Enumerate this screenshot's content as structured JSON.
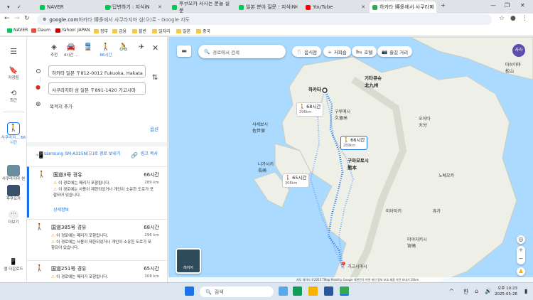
{
  "tabs": [
    {
      "label": "NAVER",
      "color": "#03c75a"
    },
    {
      "label": "답변하기 : 지식iN",
      "color": "#03c75a"
    },
    {
      "label": "후쿠오카 사시는 분들 질문",
      "color": "#03c75a"
    },
    {
      "label": "일본 분야 질문 : 지식iN",
      "color": "#03c75a"
    },
    {
      "label": "YouTube",
      "color": "#ff0000"
    },
    {
      "label": "하카타 博多에서 사쿠라지",
      "color": "#34a853"
    }
  ],
  "address": {
    "host": "google.com",
    "rest": " 하카타 博多에서 사쿠라지마 섬(으)로 - Google 지도"
  },
  "bookmarks": [
    "NAVER",
    "Daum",
    "Yahoo! JAPAN",
    "정부",
    "금융",
    "블반",
    "일자리",
    "일본",
    "중국"
  ],
  "rail": {
    "menu_icon": "menu-icon",
    "saved": "저장됨",
    "recent": "최근",
    "current": "사쿠라지... 66시간",
    "item2": "사쿠라지마 섬",
    "item3": "후쿠오카",
    "more": "더보기",
    "download": "앱 다운로드"
  },
  "modes": [
    {
      "label": "추천",
      "icon": "◈"
    },
    {
      "label": "4시간 ...",
      "icon": "🚘"
    },
    {
      "label": "",
      "icon": "🚆"
    },
    {
      "label": "66시간",
      "icon": "🚶"
    },
    {
      "label": "",
      "icon": "🚴"
    },
    {
      "label": "",
      "icon": "✈"
    }
  ],
  "origin": "하카타 일본 〒812-0012 Fukuoka, Hakata",
  "destination": "사쿠라지마 섬 일본 〒891-1420 가고시마",
  "add_destination": "목적지 추가",
  "options_label": "옵션",
  "send_to_device": "samsung SM-A325N(으)로 경로 보내기",
  "copy_link": "링크 복사",
  "routes": [
    {
      "name": "国道3号 경유",
      "time": "66시간",
      "distance": "289 km",
      "warnings": [
        "이 경로에는 페리가 포함됩니다.",
        "이 경로에는 사용이 제한되었거나 개인이 소유한 도로가 포함되어 있습니다."
      ],
      "details": "상세정보"
    },
    {
      "name": "国道385号 경유",
      "time": "68시간",
      "distance": "296 km",
      "warnings": [
        "이 경로에는 페리가 포함됩니다.",
        "이 경로에는 사용이 제한되었거나 개인이 소유한 도로가 포함되어 있습니다."
      ]
    },
    {
      "name": "国道251号 경유",
      "time": "65시간",
      "distance": "308 km",
      "warnings": [
        "이 경로에는 페리가 포함됩니다."
      ]
    }
  ],
  "map": {
    "search_placeholder": "경로에서 검색",
    "chips": [
      "음식점",
      "커피숍",
      "호텔",
      "즐길 거리"
    ],
    "avatar": "사라",
    "layer_label": "레이어",
    "callouts": [
      {
        "time": "68시간",
        "km": "296km"
      },
      {
        "time": "66시간",
        "km": "289km"
      },
      {
        "time": "65시간",
        "km": "308km"
      }
    ],
    "labels": {
      "hakata": "하카타",
      "kitakyushu": "기타큐슈\n北九州",
      "kurume": "구루메시\n久留米",
      "oita": "오이타\n大分",
      "sasebo": "사세보시\n佐世保",
      "nagasaki": "나가사키\n長崎",
      "kumamoto": "구마모토시\n熊本",
      "miyazaki": "미야자키",
      "miyazaki_city": "미야자키시\n宮崎",
      "kagoshima": "가고시마시",
      "matsuyama": "마쓰야마\n松山",
      "nobeoka": "노베오카",
      "hyuga": "휴가"
    },
    "footer": "지도 데이터 ©2025 TMap Mobility Google  대한민국  약관  개인 정보 보호  제품 의견 보내기  20km"
  },
  "taskbar": {
    "search": "검색",
    "time": "오후 10:23",
    "date": "2025-05-26",
    "lang": "한"
  }
}
